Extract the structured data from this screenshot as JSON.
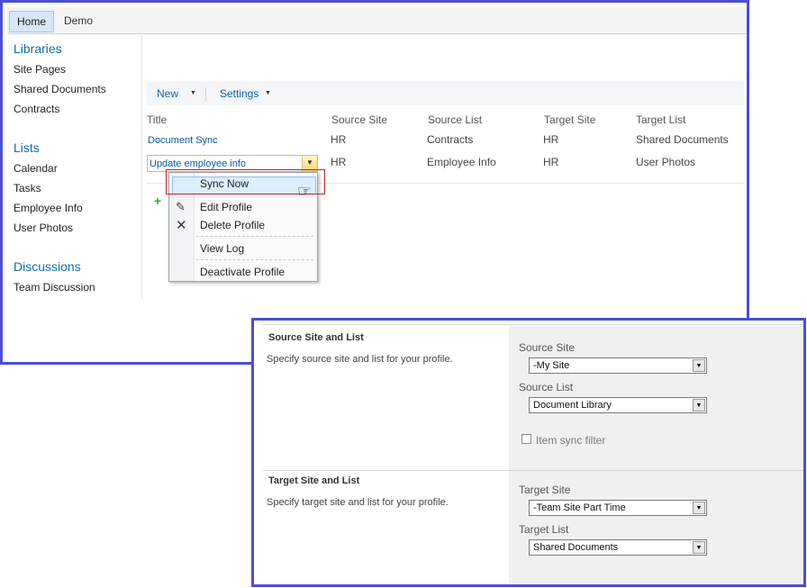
{
  "top_nav": {
    "tabs": [
      "Home",
      "Demo"
    ]
  },
  "quick_launch": {
    "libraries": {
      "heading": "Libraries",
      "items": [
        "Site Pages",
        "Shared Documents",
        "Contracts"
      ]
    },
    "lists": {
      "heading": "Lists",
      "items": [
        "Calendar",
        "Tasks",
        "Employee Info",
        "User Photos"
      ]
    },
    "discussions": {
      "heading": "Discussions",
      "items": [
        "Team Discussion"
      ]
    }
  },
  "toolbar": {
    "new_label": "New",
    "settings_label": "Settings"
  },
  "table": {
    "headers": [
      "Title",
      "Source Site",
      "Source List",
      "Target Site",
      "Target List"
    ],
    "rows": [
      {
        "title": "Document Sync",
        "source_site": "HR",
        "source_list": "Contracts",
        "target_site": "HR",
        "target_list": "Shared Documents"
      },
      {
        "title": "Update employee info",
        "source_site": "HR",
        "source_list": "Employee Info",
        "target_site": "HR",
        "target_list": "User Photos"
      }
    ]
  },
  "context_menu": {
    "items": [
      "Sync Now",
      "Edit Profile",
      "Delete Profile",
      "View Log",
      "Deactivate Profile"
    ],
    "highlighted": "Sync Now"
  },
  "form": {
    "source": {
      "title": "Source Site and List",
      "description": "Specify source site and list for your profile.",
      "site_label": "Source Site",
      "site_value": "-My Site",
      "list_label": "Source List",
      "list_value": "Document Library",
      "filter_label": "Item sync filter",
      "filter_checked": false
    },
    "target": {
      "title": "Target Site and List",
      "description": "Specify target site and list for your profile.",
      "site_label": "Target Site",
      "site_value": "-Team Site Part Time",
      "list_label": "Target List",
      "list_value": "Shared Documents"
    }
  },
  "colors": {
    "window_border": "#4a4ed4",
    "link": "#0b59a3",
    "heading": "#0f6fb3",
    "highlight_frame": "#c2201e"
  }
}
